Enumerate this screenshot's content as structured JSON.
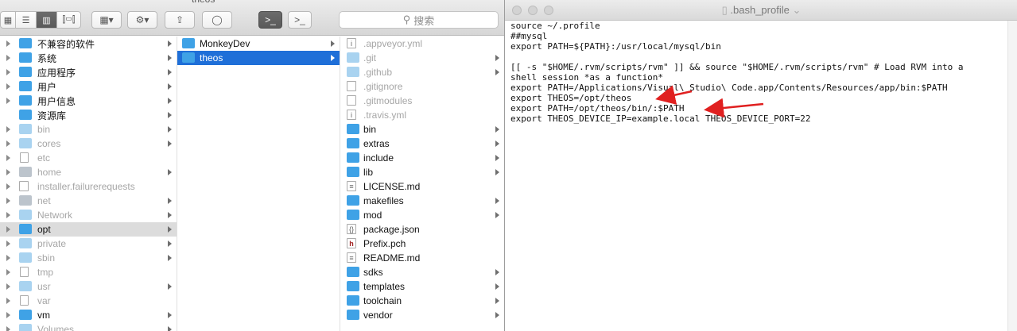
{
  "finder": {
    "window_title": "theos",
    "search_placeholder": "搜索",
    "view_buttons": [
      "icon-view-icon",
      "list-view-icon",
      "column-view-icon",
      "coverflow-view-icon"
    ],
    "col1": [
      {
        "label": "不兼容的软件",
        "icon": "folder",
        "disclosure": true,
        "arrow": true
      },
      {
        "label": "系统",
        "icon": "system-folder",
        "disclosure": true,
        "arrow": true
      },
      {
        "label": "应用程序",
        "icon": "apps-folder",
        "disclosure": true,
        "arrow": true
      },
      {
        "label": "用户",
        "icon": "users-folder",
        "disclosure": true,
        "arrow": true
      },
      {
        "label": "用户信息",
        "icon": "folder",
        "disclosure": true,
        "arrow": true
      },
      {
        "label": "资源库",
        "icon": "library-folder",
        "disclosure": false,
        "arrow": true
      },
      {
        "label": "bin",
        "icon": "folder-light",
        "gray": true,
        "arrow": true
      },
      {
        "label": "cores",
        "icon": "folder-light",
        "gray": true,
        "arrow": true
      },
      {
        "label": "etc",
        "icon": "alias",
        "gray": true,
        "arrow": false
      },
      {
        "label": "home",
        "icon": "drive",
        "gray": true,
        "arrow": true
      },
      {
        "label": "installer.failurerequests",
        "icon": "file",
        "gray": true,
        "arrow": false
      },
      {
        "label": "net",
        "icon": "drive",
        "gray": true,
        "arrow": true
      },
      {
        "label": "Network",
        "icon": "folder-light",
        "gray": true,
        "arrow": true
      },
      {
        "label": "opt",
        "icon": "folder",
        "arrow": true,
        "selected": true
      },
      {
        "label": "private",
        "icon": "folder-light",
        "gray": true,
        "arrow": true
      },
      {
        "label": "sbin",
        "icon": "folder-light",
        "gray": true,
        "arrow": true
      },
      {
        "label": "tmp",
        "icon": "alias",
        "gray": true,
        "arrow": false
      },
      {
        "label": "usr",
        "icon": "folder-light",
        "gray": true,
        "arrow": true
      },
      {
        "label": "var",
        "icon": "alias",
        "gray": true,
        "arrow": false
      },
      {
        "label": "vm",
        "icon": "folder",
        "arrow": true
      },
      {
        "label": "Volumes",
        "icon": "folder-light",
        "gray": true,
        "arrow": true
      }
    ],
    "col2": [
      {
        "label": "MonkeyDev",
        "icon": "folder",
        "arrow": true
      },
      {
        "label": "theos",
        "icon": "folder",
        "arrow": true,
        "selected": true
      }
    ],
    "col3": [
      {
        "label": ".appveyor.yml",
        "icon": "file-i",
        "gray": true,
        "arrow": false
      },
      {
        "label": ".git",
        "icon": "folder-light",
        "gray": true,
        "arrow": true
      },
      {
        "label": ".github",
        "icon": "folder-light",
        "gray": true,
        "arrow": true
      },
      {
        "label": ".gitignore",
        "icon": "file",
        "gray": true,
        "arrow": false
      },
      {
        "label": ".gitmodules",
        "icon": "file",
        "gray": true,
        "arrow": false
      },
      {
        "label": ".travis.yml",
        "icon": "file-i",
        "gray": true,
        "arrow": false
      },
      {
        "label": "bin",
        "icon": "folder",
        "arrow": true
      },
      {
        "label": "extras",
        "icon": "folder",
        "arrow": true
      },
      {
        "label": "include",
        "icon": "folder",
        "arrow": true
      },
      {
        "label": "lib",
        "icon": "folder",
        "arrow": true
      },
      {
        "label": "LICENSE.md",
        "icon": "file-doc",
        "arrow": false
      },
      {
        "label": "makefiles",
        "icon": "folder",
        "arrow": true
      },
      {
        "label": "mod",
        "icon": "folder",
        "arrow": true
      },
      {
        "label": "package.json",
        "icon": "file-json",
        "arrow": false
      },
      {
        "label": "Prefix.pch",
        "icon": "file-h",
        "arrow": false
      },
      {
        "label": "README.md",
        "icon": "file-doc",
        "arrow": false
      },
      {
        "label": "sdks",
        "icon": "folder",
        "arrow": true
      },
      {
        "label": "templates",
        "icon": "folder",
        "arrow": true
      },
      {
        "label": "toolchain",
        "icon": "folder",
        "arrow": true
      },
      {
        "label": "vendor",
        "icon": "folder",
        "arrow": true
      }
    ]
  },
  "editor": {
    "title": ".bash_profile",
    "lines": [
      "source ~/.profile",
      "##mysql",
      "export PATH=${PATH}:/usr/local/mysql/bin",
      "",
      "[[ -s \"$HOME/.rvm/scripts/rvm\" ]] && source \"$HOME/.rvm/scripts/rvm\" # Load RVM into a",
      "shell session *as a function*",
      "export PATH=/Applications/Visual\\ Studio\\ Code.app/Contents/Resources/app/bin:$PATH",
      "export THEOS=/opt/theos",
      "export PATH=/opt/theos/bin/:$PATH",
      "export THEOS_DEVICE_IP=example.local THEOS_DEVICE_PORT=22"
    ],
    "annotation_color": "#e02020"
  }
}
